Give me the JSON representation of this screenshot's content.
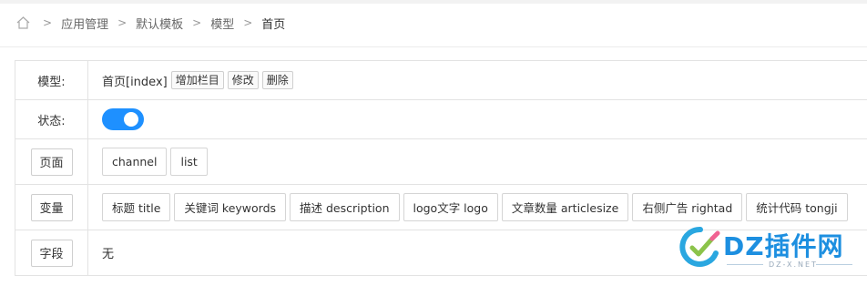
{
  "breadcrumb": {
    "home_icon": "home-icon",
    "separator": ">",
    "items": [
      "应用管理",
      "默认模板",
      "模型",
      "首页"
    ]
  },
  "rows": {
    "model": {
      "label": "模型:",
      "value": "首页[index]",
      "actions": [
        "增加栏目",
        "修改",
        "删除"
      ]
    },
    "status": {
      "label": "状态:",
      "toggle_on": true,
      "accent": "#1e90ff"
    },
    "page": {
      "label": "页面",
      "buttons": [
        "channel",
        "list"
      ]
    },
    "variable": {
      "label": "变量",
      "buttons": [
        "标题 title",
        "关键词 keywords",
        "描述 description",
        "logo文字 logo",
        "文章数量 articlesize",
        "右侧广告 rightad",
        "统计代码 tongji"
      ]
    },
    "field": {
      "label": "字段",
      "value": "无"
    }
  },
  "watermark": {
    "brand": "DZ插件网",
    "sub": "DZ-X.NET"
  }
}
